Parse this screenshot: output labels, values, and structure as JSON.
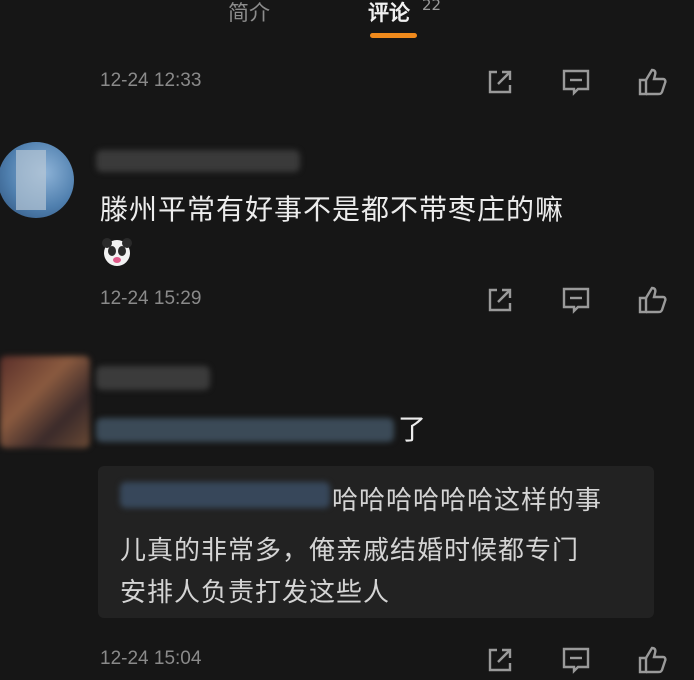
{
  "tabs": {
    "intro": "简介",
    "comments": "评论",
    "comments_count": "22"
  },
  "comments": [
    {
      "timestamp": "12-24 12:33"
    },
    {
      "text": "滕州平常有好事不是都不带枣庄的嘛",
      "timestamp": "12-24 15:29",
      "emoji": "panda-sticker-icon"
    },
    {
      "text_tail": "了",
      "reply": {
        "line1": "哈哈哈哈哈哈这样的事",
        "line2": "儿真的非常多，俺亲戚结婚时候都专门",
        "line3": "安排人负责打发这些人"
      },
      "timestamp": "12-24 15:04"
    }
  ],
  "colors": {
    "accent": "#f08a1c",
    "background": "#161616",
    "text": "#ececec",
    "muted": "#8a8a8a"
  }
}
